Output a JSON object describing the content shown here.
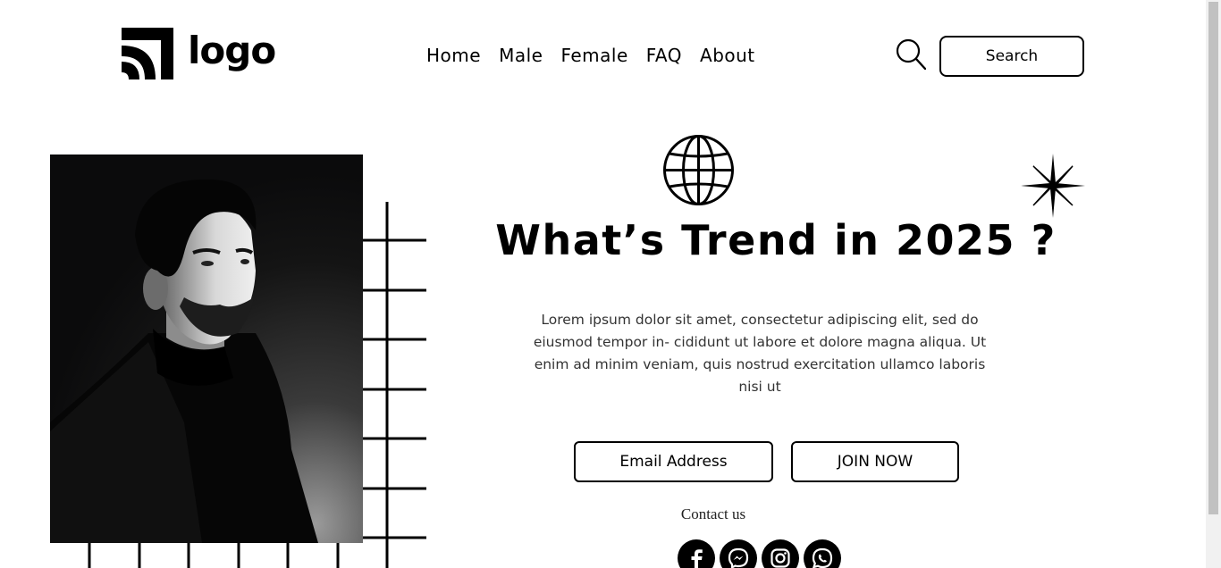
{
  "header": {
    "logo_text": "logo",
    "nav": [
      {
        "label": "Home"
      },
      {
        "label": "Male"
      },
      {
        "label": "Female"
      },
      {
        "label": "FAQ"
      },
      {
        "label": "About"
      }
    ],
    "search_label": "Search"
  },
  "hero": {
    "title": "What’s Trend in 2025 ?",
    "body": "Lorem ipsum dolor sit amet, consectetur adipiscing elit, sed do eiusmod tempor in- cididunt ut labore et dolore magna aliqua. Ut enim ad minim veniam, quis nostrud exercitation ullamco laboris nisi ut",
    "email_placeholder": "Email Address",
    "join_label": "JOIN NOW"
  },
  "contact": {
    "title": "Contact us",
    "socials": [
      {
        "icon": "facebook-icon"
      },
      {
        "icon": "messenger-icon"
      },
      {
        "icon": "instagram-icon"
      },
      {
        "icon": "whatsapp-icon"
      }
    ]
  },
  "colors": {
    "primary": "#000000",
    "background": "#ffffff"
  }
}
